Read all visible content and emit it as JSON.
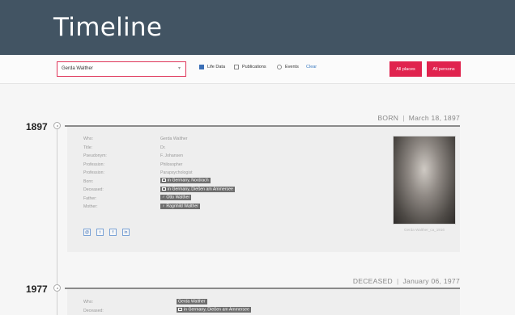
{
  "header": {
    "title": "Timeline"
  },
  "filters": {
    "person_value": "Gerda Walther",
    "life_data_label": "Life Data",
    "publications_label": "Publications",
    "events_label": "Events",
    "clear_label": "Clear",
    "all_places_label": "All places",
    "all_persons_label": "All persons"
  },
  "events": [
    {
      "year": "1897",
      "type": "BORN",
      "date": "March 18, 1897",
      "rows": [
        {
          "label": "Who:",
          "value": "Gerda Walther"
        },
        {
          "label": "Title:",
          "value": "Dr."
        },
        {
          "label": "Pseudonym:",
          "value": "F. Johansen"
        },
        {
          "label": "Profession:",
          "value": "Philosopher"
        },
        {
          "label": "Profession:",
          "value": "Parapsychologist"
        },
        {
          "label": "Born:",
          "value": "in Germany, Nordrach"
        },
        {
          "label": "Deceased:",
          "value": "in Germany, Dießen am Ammersee"
        },
        {
          "label": "Father:",
          "value": "Otto Walther"
        },
        {
          "label": "Mother:",
          "value": "Ragnhild Walther"
        }
      ],
      "photo_caption": "Gerda Walther_ca_1916",
      "social": [
        "@",
        "t",
        "f",
        "in"
      ]
    },
    {
      "year": "1977",
      "type": "DECEASED",
      "date": "January 06, 1977",
      "rows": [
        {
          "label": "Who:",
          "value": "Gerda Walther"
        },
        {
          "label": "Deceased:",
          "value": "in Germany, Dießen am Ammersee"
        }
      ]
    }
  ],
  "colors": {
    "header_bg": "#425463",
    "accent_red": "#e0234e",
    "tag_bg": "#6d6d6d"
  }
}
